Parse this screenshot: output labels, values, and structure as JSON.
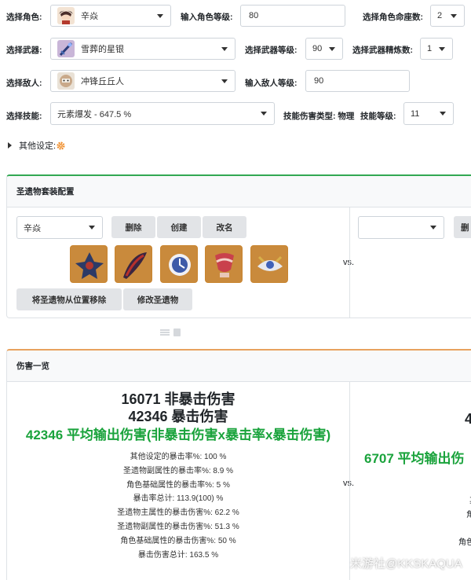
{
  "form": {
    "character": {
      "label": "选择角色:",
      "value": "辛焱"
    },
    "char_level": {
      "label": "输入角色等级:",
      "value": "80"
    },
    "constellation": {
      "label": "选择角色命座数:",
      "value": "2"
    },
    "weapon": {
      "label": "选择武器:",
      "value": "雪葬的星银"
    },
    "weapon_level": {
      "label": "选择武器等级:",
      "value": "90"
    },
    "refinement": {
      "label": "选择武器精炼数:",
      "value": "1"
    },
    "enemy": {
      "label": "选择敌人:",
      "value": "冲锋丘丘人"
    },
    "enemy_level": {
      "label": "输入敌人等级:",
      "value": "90"
    },
    "skill": {
      "label": "选择技能:",
      "value": "元素爆发 - 647.5 %"
    },
    "damage_type": {
      "label": "技能伤害类型:",
      "value": "物理"
    },
    "skill_level": {
      "label": "技能等级:",
      "value": "11"
    },
    "other_settings": {
      "label": "其他设定:"
    }
  },
  "artifact_panel": {
    "title": "圣遗物套装配置",
    "preset_value": "辛焱",
    "buttons": {
      "delete": "删除",
      "create": "创建",
      "rename": "改名",
      "remove": "将圣遗物从位置移除",
      "edit": "修改圣遗物"
    },
    "right_delete_partial": "删",
    "vs": "vs."
  },
  "damage_panel": {
    "title": "伤害一览",
    "left": {
      "non_crit": "16071 非暴击伤害",
      "crit": "42346 暴击伤害",
      "avg": "42346 平均输出伤害(非暴击伤害x暴击率x暴击伤害)",
      "stats": [
        "其他设定的暴击率%: 100 %",
        "圣遗物副属性的暴击率%: 8.9 %",
        "角色基础属性的暴击率%: 5 %",
        "暴击率总计: 113.9(100) %",
        "圣遗物主属性的暴击伤害%: 62.2 %",
        "圣遗物副属性的暴击伤害%: 51.3 %",
        "角色基础属性的暴击伤害%: 50 %",
        "暴击伤害总计: 163.5 %"
      ]
    },
    "right_partial": {
      "crit_partial": "4",
      "avg_partial": "6707 平均输出伤",
      "stat_partials": [
        "其",
        "角",
        "角色"
      ]
    },
    "vs": "vs."
  },
  "watermark": "米游社@KKSKAQUA",
  "colors": {
    "accent_green": "#1aa33c",
    "artifact_border_top": "#32a852",
    "damage_border_top": "#e8a25e"
  },
  "icons": {
    "settings": "orange-gear-icon",
    "expand": "caret-right-icon"
  }
}
